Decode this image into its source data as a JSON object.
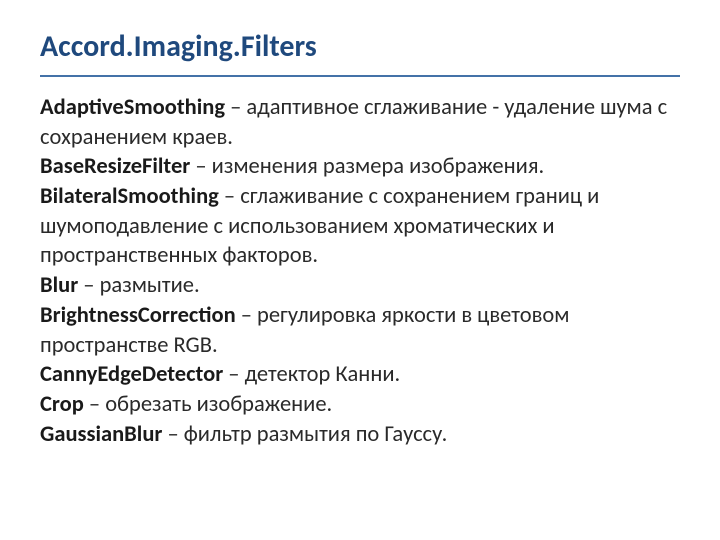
{
  "title": "Accord.Imaging.Filters",
  "items": [
    {
      "term": "AdaptiveSmoothing",
      "desc": " – адаптивное сглаживание - удаление шума с сохранением краев."
    },
    {
      "term": "BaseResizeFilter",
      "desc": " – изменения размера изображения."
    },
    {
      "term": "BilateralSmoothing",
      "desc": " – сглаживание с сохранением границ и шумоподавление с использованием хроматических и пространственных факторов."
    },
    {
      "term": "Blur",
      "desc": " – размытие."
    },
    {
      "term": "BrightnessCorrection",
      "desc": " – регулировка яркости в цветовом пространстве RGB."
    },
    {
      "term": "CannyEdgeDetector",
      "desc": " – детектор Канни."
    },
    {
      "term": "Crop",
      "desc": " – обрезать изображение."
    },
    {
      "term": "GaussianBlur",
      "desc": " – фильтр размытия по Гауссу."
    }
  ]
}
